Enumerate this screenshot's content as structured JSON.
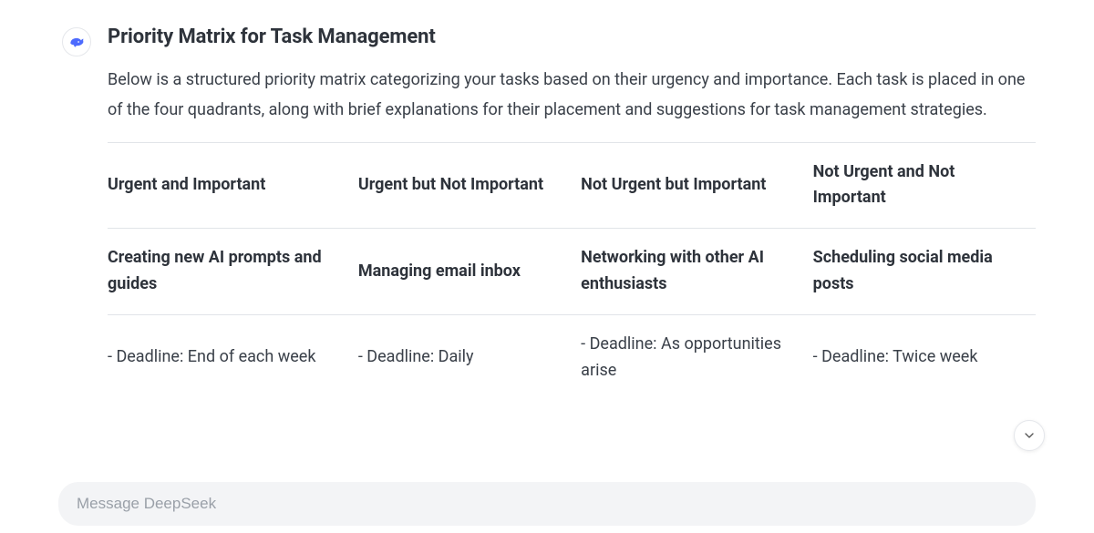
{
  "response": {
    "title": "Priority Matrix for Task Management",
    "intro": "Below is a structured priority matrix categorizing your tasks based on their urgency and importance. Each task is placed in one of the four quadrants, along with brief explanations for their placement and suggestions for task management strategies."
  },
  "table": {
    "headers": {
      "c1": "Urgent and Important",
      "c2": "Urgent but Not Important",
      "c3": "Not Urgent but Important",
      "c4": "Not Urgent and Not Important"
    },
    "row_tasks": {
      "c1": "Creating new AI prompts and guides",
      "c2": "Managing email inbox",
      "c3": "Networking with other AI enthusiasts",
      "c4": "Scheduling social media posts"
    },
    "row_deadlines": {
      "c1": "- Deadline: End of each week",
      "c2": "- Deadline: Daily",
      "c3": "- Deadline: As opportunities arise",
      "c4": "- Deadline: Twice week"
    }
  },
  "composer": {
    "placeholder": "Message DeepSeek"
  },
  "icons": {
    "avatar": "deepseek-whale-icon",
    "scroll": "chevron-down-icon"
  }
}
